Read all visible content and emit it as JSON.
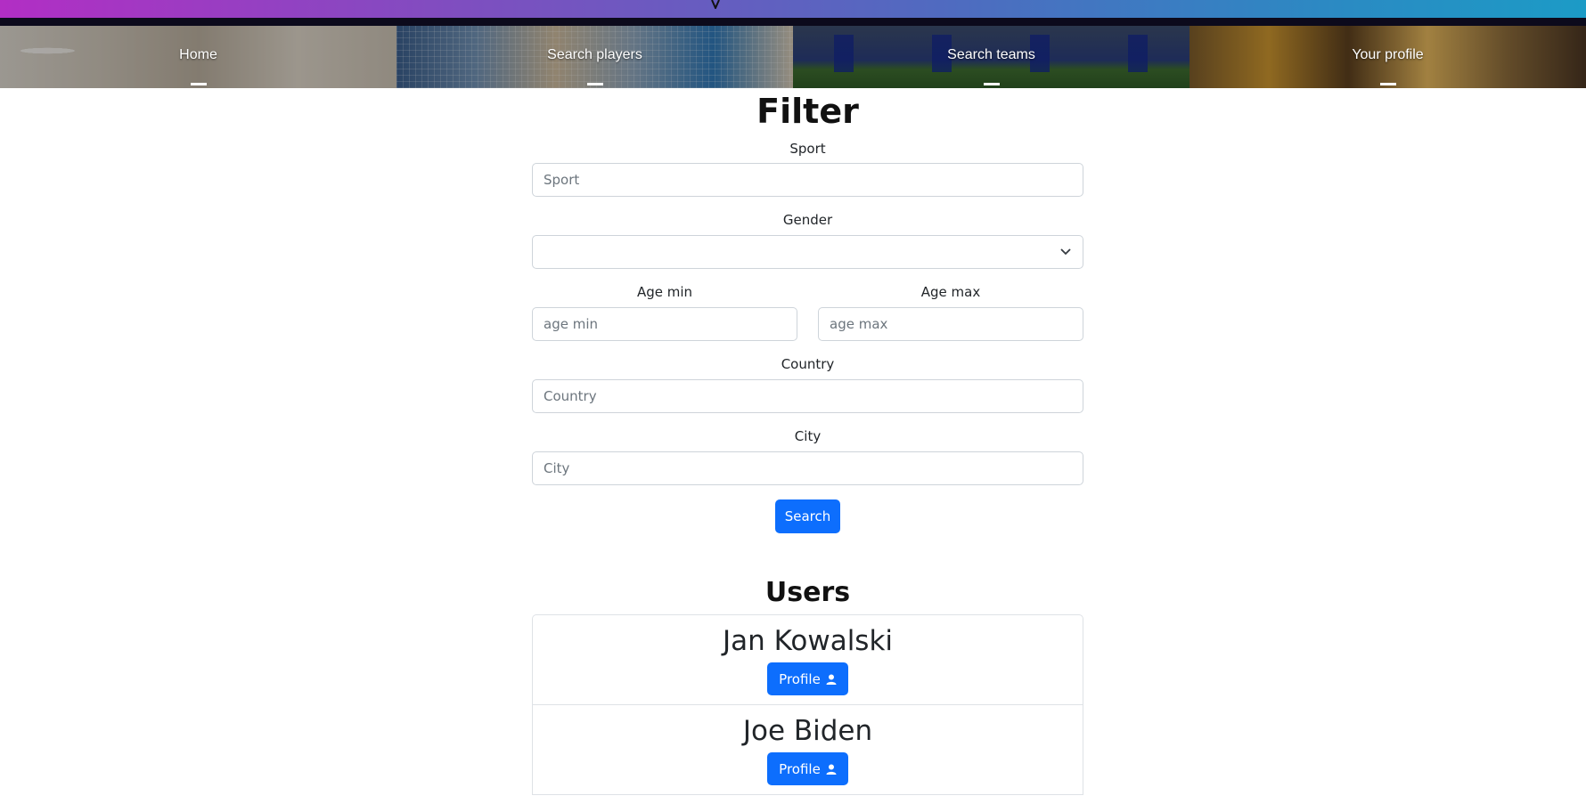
{
  "nav": {
    "tiles": [
      {
        "label": "Home"
      },
      {
        "label": "Search players"
      },
      {
        "label": "Search teams"
      },
      {
        "label": "Your profile"
      }
    ]
  },
  "filter": {
    "title": "Filter",
    "sport": {
      "label": "Sport",
      "placeholder": "Sport"
    },
    "gender": {
      "label": "Gender",
      "value": ""
    },
    "age_min": {
      "label": "Age min",
      "placeholder": "age min"
    },
    "age_max": {
      "label": "Age max",
      "placeholder": "age max"
    },
    "country": {
      "label": "Country",
      "placeholder": "Country"
    },
    "city": {
      "label": "City",
      "placeholder": "City"
    },
    "search_button": "Search"
  },
  "users": {
    "title": "Users",
    "items": [
      {
        "name": "Jan Kowalski",
        "button": "Profile"
      },
      {
        "name": "Joe Biden",
        "button": "Profile"
      }
    ]
  },
  "colors": {
    "primary": "#0d6efd",
    "header_gradient_start": "#b22ec4",
    "header_gradient_end": "#1c9bc6"
  },
  "icons": {
    "select_caret": "chevron-down-icon",
    "profile_button": "person-icon"
  }
}
